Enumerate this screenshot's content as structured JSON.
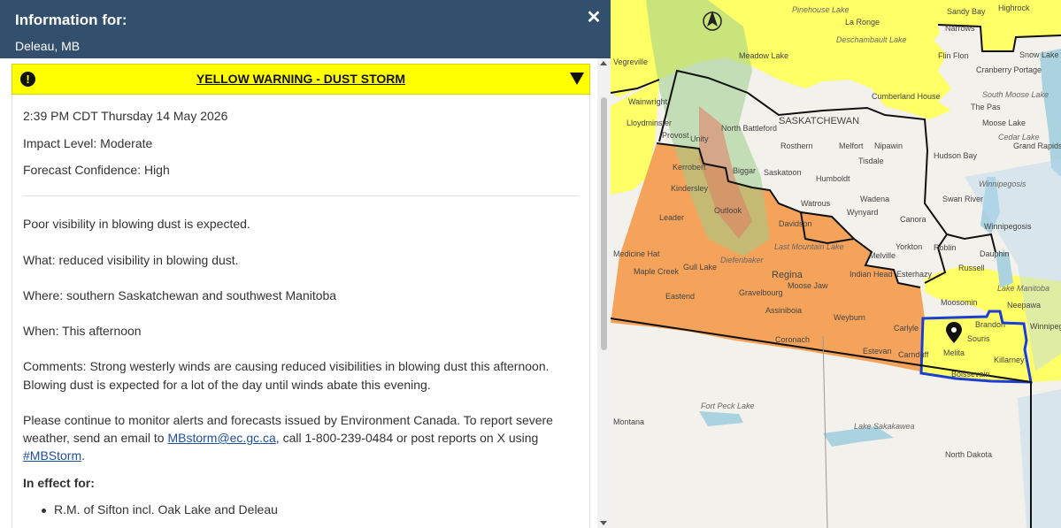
{
  "panel": {
    "title": "Information for:",
    "location": "Deleau, MB",
    "close_label": "✕"
  },
  "warning": {
    "icon": "!",
    "title": "YELLOW WARNING - DUST STORM",
    "color": "#ffff00"
  },
  "details": {
    "issued": "2:39 PM CDT Thursday 14 May 2026",
    "impact": "Impact Level: Moderate",
    "confidence": "Forecast Confidence: High",
    "summary": "Poor visibility in blowing dust is expected.",
    "what": "What: reduced visibility in blowing dust.",
    "where": "Where: southern Saskatchewan and southwest Manitoba",
    "when": "When: This afternoon",
    "comments_line1": "Comments: Strong westerly winds are causing reduced visibilities in blowing dust this afternoon.",
    "comments_line2": "Blowing dust is expected for a lot of the day until winds abate this evening.",
    "contact_line1": "Please continue to monitor alerts and forecasts issued by Environment Canada. To report severe",
    "contact_prefix": "weather, send an email to ",
    "contact_email": "MBstorm@ec.gc.ca",
    "contact_mid": ", call 1-800-239-0484 or post reports on X using",
    "contact_hashtag": "#MBStorm",
    "contact_end": ".",
    "in_effect_heading": "In effect for:",
    "in_effect_items": [
      "R.M. of Sifton incl. Oak Lake and Deleau"
    ]
  },
  "map": {
    "colors": {
      "yellow": "#ffff66",
      "orange": "#f5a35a",
      "land": "#f3f1ec",
      "selected_border": "#1c3fd1"
    },
    "labels": {
      "pinehouse_lake": "Pinehouse Lake",
      "la_ronge": "La Ronge",
      "sandy_bay": "Sandy Bay",
      "highrock": "Highrock",
      "deschambault_lake": "Deschambault Lake",
      "narrows": "Narrows",
      "snow_lake": "Snow Lake",
      "meadow_lake": "Meadow Lake",
      "flin_flon": "Flin Flon",
      "cranberry_portage": "Cranberry Portage",
      "vegreville": "Vegreville",
      "cumberland_house": "Cumberland House",
      "the_pas": "The Pas",
      "south_moose_lake": "South Moose Lake",
      "moose_lake": "Moose Lake",
      "wainwright": "Wainwright",
      "saskatchewan": "SASKATCHEWAN",
      "nipawin": "Nipawin",
      "north_battleford": "North Battleford",
      "lloydminster": "Lloydminster",
      "cedar_lake": "Cedar Lake",
      "grand_rapids": "Grand Rapids",
      "provost": "Provost",
      "unity": "Unity",
      "rosthern": "Rosthern",
      "melfort": "Melfort",
      "tisdale": "Tisdale",
      "hudson_bay": "Hudson Bay",
      "winnipegosis_lake": "Winnipegosis",
      "kerrobert": "Kerrobert",
      "biggar": "Biggar",
      "saskatoon": "Saskatoon",
      "humboldt": "Humboldt",
      "wadena": "Wadena",
      "swan_river": "Swan River",
      "kindersley": "Kindersley",
      "watrous": "Watrous",
      "wynyard": "Wynyard",
      "canora": "Canora",
      "winnipegosis": "Winnipegosis",
      "leader": "Leader",
      "outlook": "Outlook",
      "davidson": "Davidson",
      "yorkton": "Yorkton",
      "roblin": "Roblin",
      "dauphin": "Dauphin",
      "medicine_hat": "Medicine Hat",
      "last_mountain_lake": "Last Mountain Lake",
      "melville": "Melville",
      "gull_lake": "Gull Lake",
      "diefenbaker": "Diefenbaker",
      "indian_head": "Indian Head",
      "esterhazy": "Esterhazy",
      "russell": "Russell",
      "maple_creek": "Maple Creek",
      "regina": "Regina",
      "moose_jaw": "Moose Jaw",
      "moosomin": "Moosomin",
      "lake_manitoba": "Lake Manitoba",
      "neepawa": "Neepawa",
      "eastend": "Eastend",
      "gravelbourg": "Gravelbourg",
      "brandon": "Brandon",
      "winnipeg": "Winnipeg",
      "assiniboia": "Assiniboia",
      "weyburn": "Weyburn",
      "carlyle": "Carlyle",
      "souris": "Souris",
      "coronach": "Coronach",
      "estevan": "Estevan",
      "carnduff": "Carnduff",
      "melita": "Melita",
      "killarney": "Killarney",
      "boissevain": "Boissevain",
      "fort_peck_lake": "Fort Peck Lake",
      "montana": "Montana",
      "lake_sakakawea": "Lake Sakakawea",
      "north_dakota": "North Dakota"
    },
    "compass_icon": "north-arrow-icon",
    "marker_icon": "location-pin-icon"
  }
}
